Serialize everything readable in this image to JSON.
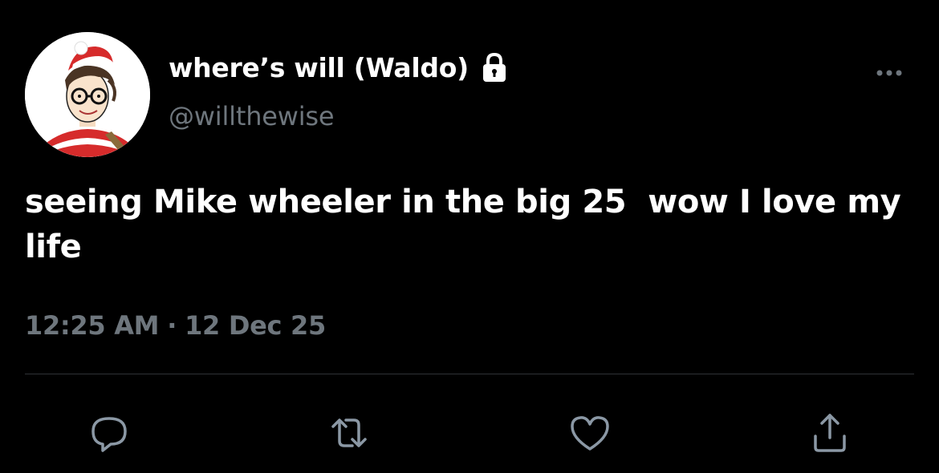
{
  "tweet": {
    "display_name": "where’s will (Waldo)",
    "handle": "@willthewise",
    "text": "seeing Mike wheeler in the big 25  wow I love my life",
    "time": "12:25 AM",
    "separator": "·",
    "date": "12 Dec 25",
    "protected_icon": "lock-icon",
    "avatar_icon": "waldo-avatar"
  },
  "actions": {
    "reply_icon": "reply-icon",
    "retweet_icon": "retweet-icon",
    "like_icon": "heart-icon",
    "share_icon": "share-icon",
    "more_icon": "more-icon"
  },
  "colors": {
    "background": "#000000",
    "text_primary": "#ffffff",
    "text_secondary": "#6e767d",
    "divider": "#2f3336"
  }
}
